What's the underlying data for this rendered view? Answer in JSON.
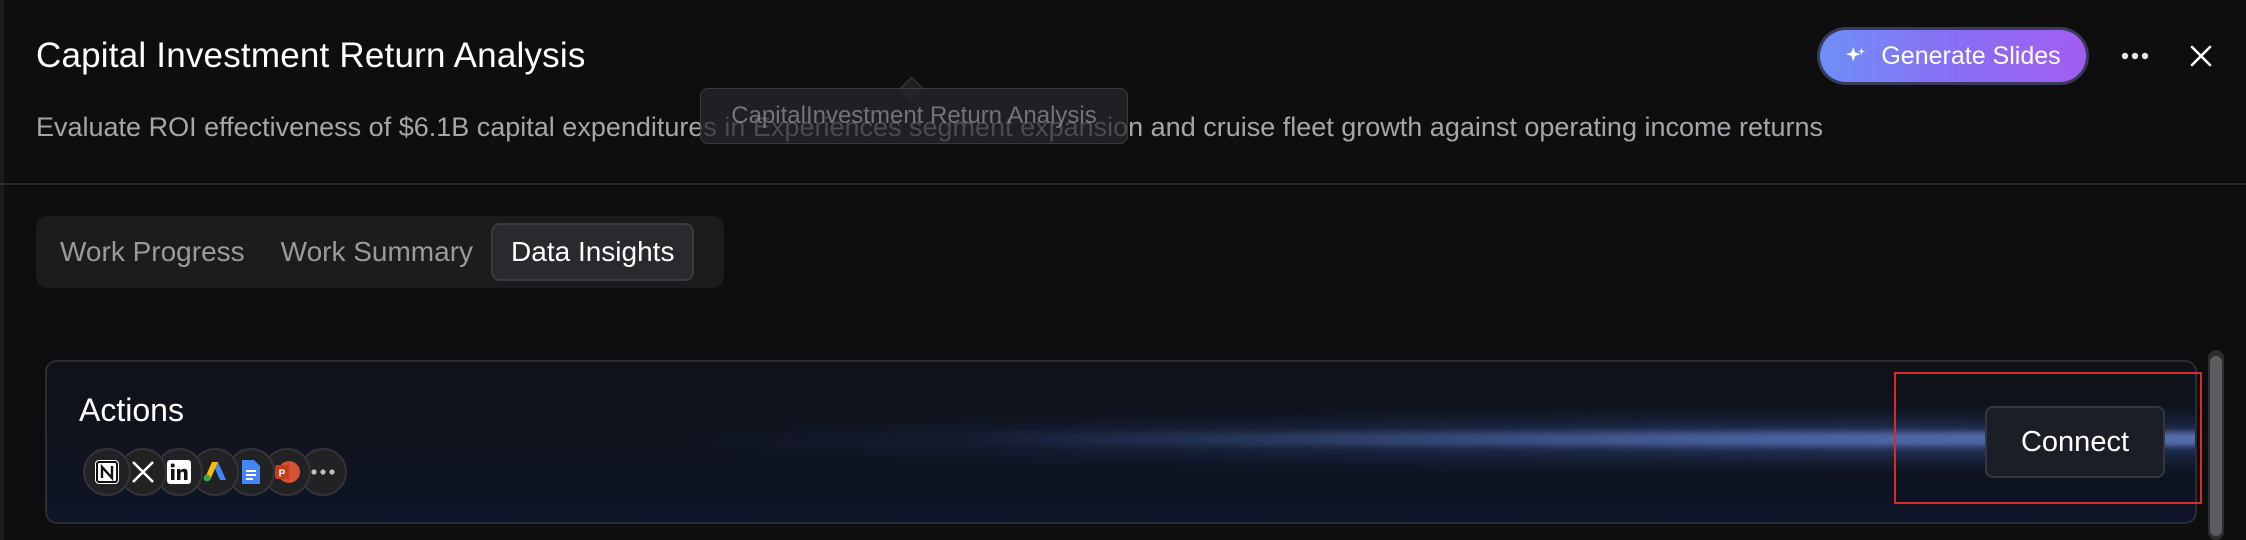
{
  "header": {
    "title": "Capital Investment Return Analysis",
    "subtitle": "Evaluate ROI effectiveness of $6.1B capital expenditures in Experiences segment expansion and cruise fleet growth against operating income returns",
    "tooltip": "CapitalInvestment Return Analysis",
    "generate_label": "Generate Slides"
  },
  "tabs": [
    {
      "label": "Work Progress",
      "active": false
    },
    {
      "label": "Work Summary",
      "active": false
    },
    {
      "label": "Data Insights",
      "active": true
    }
  ],
  "actions": {
    "title": "Actions",
    "connect_label": "Connect",
    "apps": [
      "notion-icon",
      "x-icon",
      "linkedin-icon",
      "google-ads-icon",
      "google-docs-icon",
      "powerpoint-icon",
      "more-apps-icon"
    ]
  },
  "colors": {
    "background": "#0e0e0f",
    "gradient_start": "#6f8ff7",
    "gradient_end": "#a15ef0",
    "highlight": "#d92b2b"
  }
}
